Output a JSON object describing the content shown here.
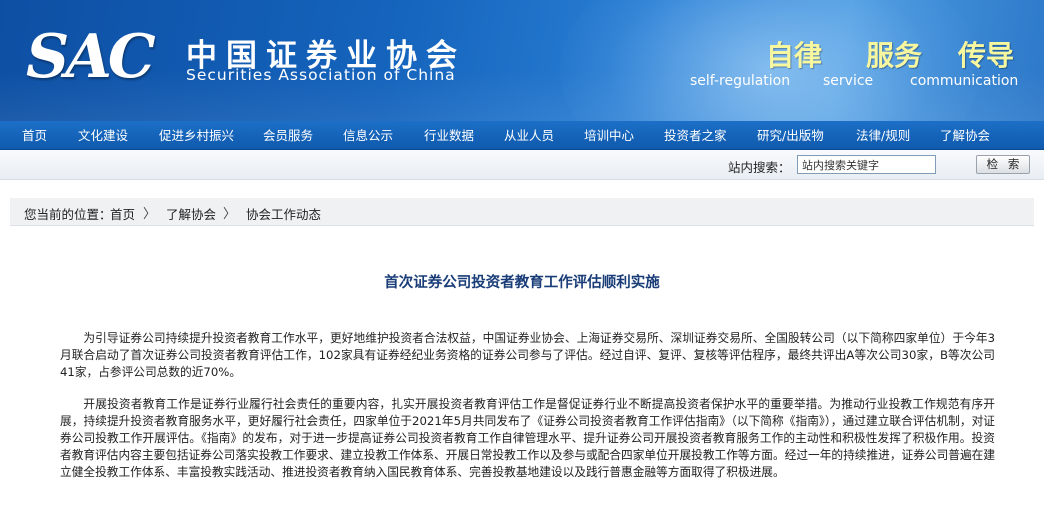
{
  "header": {
    "logo_mark": "SAC",
    "org_name_cn": "中国证券业协会",
    "org_name_en": "Securities Association of China",
    "slogans": [
      {
        "cn": "自律",
        "en": "self-regulation"
      },
      {
        "cn": "服务",
        "en": "service"
      },
      {
        "cn": "传导",
        "en": "communication"
      }
    ],
    "colors": {
      "banner": "#1564bd",
      "slogan": "#f7f7a0",
      "nav": "#1462b8",
      "title": "#1a3d78"
    }
  },
  "nav": {
    "items": [
      "首页",
      "文化建设",
      "促进乡村振兴",
      "会员服务",
      "信息公示",
      "行业数据",
      "从业人员",
      "培训中心",
      "投资者之家",
      "研究/出版物",
      "法律/规则",
      "了解协会"
    ]
  },
  "search": {
    "label": "站内搜索：",
    "value": "站内搜索关键字",
    "button_label": "检 索"
  },
  "breadcrumb": {
    "prefix": "您当前的位置：",
    "items": [
      "首页",
      "了解协会",
      "协会工作动态"
    ],
    "separator": "〉"
  },
  "article": {
    "title": "首次证券公司投资者教育工作评估顺利实施",
    "paragraphs": [
      "为引导证券公司持续提升投资者教育工作水平，更好地维护投资者合法权益，中国证券业协会、上海证券交易所、深圳证券交易所、全国股转公司（以下简称四家单位）于今年3月联合启动了首次证券公司投资者教育评估工作，102家具有证券经纪业务资格的证券公司参与了评估。经过自评、复评、复核等评估程序，最终共评出A等次公司30家，B等次公司41家，占参评公司总数的近70%。",
      "开展投资者教育工作是证券行业履行社会责任的重要内容，扎实开展投资者教育评估工作是督促证券行业不断提高投资者保护水平的重要举措。为推动行业投教工作规范有序开展，持续提升投资者教育服务水平，更好履行社会责任，四家单位于2021年5月共同发布了《证券公司投资者教育工作评估指南》（以下简称《指南》），通过建立联合评估机制，对证券公司投教工作开展评估。《指南》的发布，对于进一步提高证券公司投资者教育工作自律管理水平、提升证券公司开展投资者教育服务工作的主动性和积极性发挥了积极作用。投资者教育评估内容主要包括证券公司落实投教工作要求、建立投教工作体系、开展日常投教工作以及参与或配合四家单位开展投教工作等方面。经过一年的持续推进，证券公司普遍在建立健全投教工作体系、丰富投教实践活动、推进投资者教育纳入国民教育体系、完善投教基地建设以及践行普惠金融等方面取得了积极进展。"
    ]
  }
}
